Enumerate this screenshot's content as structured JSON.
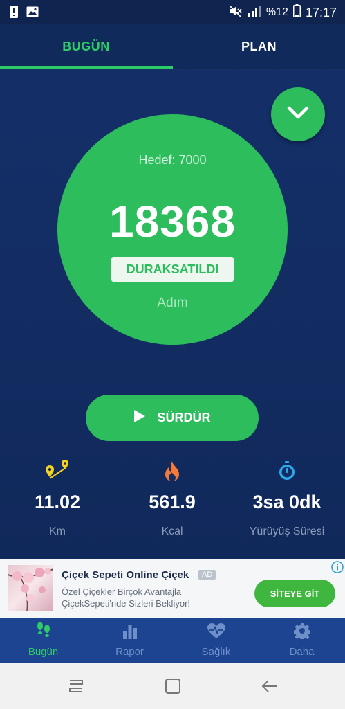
{
  "status_bar": {
    "battery_percent": "%12",
    "time": "17:17",
    "icons": [
      "alert-icon",
      "image-icon",
      "mute-icon",
      "signal-icon",
      "battery-icon"
    ]
  },
  "tabs": [
    {
      "label": "BUGÜN",
      "active": true
    },
    {
      "label": "PLAN",
      "active": false
    }
  ],
  "counter": {
    "goal_label": "Hedef: 7000",
    "steps": "18368",
    "status": "DURAKSATILDI",
    "unit": "Adım"
  },
  "resume_button": {
    "label": "SÜRDÜR",
    "icon": "play-icon"
  },
  "stats": [
    {
      "value": "11.02",
      "label": "Km",
      "icon": "route-icon"
    },
    {
      "value": "561.9",
      "label": "Kcal",
      "icon": "flame-icon"
    },
    {
      "value": "3sa 0dk",
      "label": "Yürüyüş Süresi",
      "icon": "stopwatch-icon"
    }
  ],
  "ad": {
    "title": "Çiçek Sepeti Online Çiçek",
    "tag": "AD",
    "description_line1": "Özel Çiçekler Birçok Avantajla",
    "description_line2": "ÇiçekSepeti'nde Sizleri Bekliyor!",
    "cta": "SİTEYE GİT"
  },
  "bottom_nav": [
    {
      "label": "Bugün",
      "icon": "footsteps-icon",
      "active": true
    },
    {
      "label": "Rapor",
      "icon": "bar-chart-icon",
      "active": false
    },
    {
      "label": "Sağlık",
      "icon": "heart-pulse-icon",
      "active": false
    },
    {
      "label": "Daha",
      "icon": "gear-icon",
      "active": false
    }
  ],
  "colors": {
    "accent": "#2dbd5c",
    "background": "#132d63",
    "nav_bar": "#1c4490",
    "stat_label": "#8c9bb8"
  }
}
